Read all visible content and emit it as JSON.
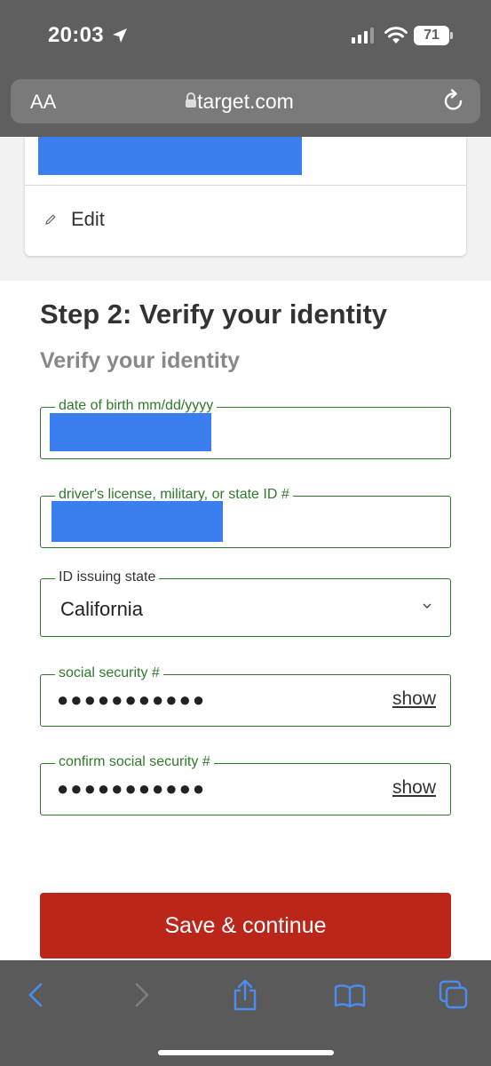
{
  "status_bar": {
    "time": "20:03",
    "battery": "71"
  },
  "browser": {
    "aa_label": "AA",
    "url": "target.com"
  },
  "card": {
    "edit_label": "Edit"
  },
  "form": {
    "step_title": "Step 2: Verify your identity",
    "subtitle": "Verify your identity",
    "dob_label": "date of birth mm/dd/yyyy",
    "id_label": "driver's license, military, or state ID #",
    "state_label": "ID issuing state",
    "state_value": "California",
    "ssn_label": "social security #",
    "ssn_value": "●●●●●●●●●●●",
    "ssn_show": "show",
    "confirm_ssn_label": "confirm social security #",
    "confirm_ssn_value": "●●●●●●●●●●●",
    "confirm_ssn_show": "show",
    "save_label": "Save & continue"
  },
  "colors": {
    "accent": "#bb261b",
    "field_border": "#2f7a2a",
    "redaction": "#3a7ef0",
    "toolbar_icon": "#4a8cf0"
  },
  "icons": [
    "location-arrow-icon",
    "signal-icon",
    "wifi-icon",
    "battery-icon",
    "lock-icon",
    "reload-icon",
    "pencil-icon",
    "chevron-down-icon",
    "back-icon",
    "forward-icon",
    "share-icon",
    "bookmarks-icon",
    "tabs-icon"
  ]
}
